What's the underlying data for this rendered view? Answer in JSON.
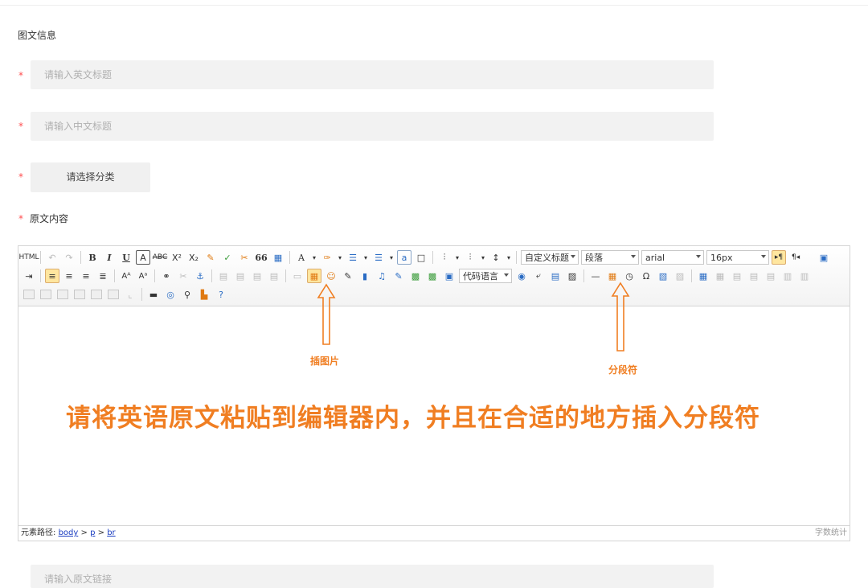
{
  "section_title": "图文信息",
  "required_mark": "*",
  "fields": {
    "english_title_placeholder": "请输入英文标题",
    "chinese_title_placeholder": "请输入中文标题",
    "category_button": "请选择分类",
    "content_label": "原文内容",
    "source_link_placeholder": "请输入原文链接"
  },
  "toolbar": {
    "row1": [
      "HTML",
      "↶",
      "↷",
      "B",
      "I",
      "U",
      "A",
      "ABC",
      "X²",
      "X₂",
      "✎",
      "✓",
      "✂",
      "66",
      "▦",
      "A",
      "▾",
      "✑",
      "▾",
      "☰",
      "▾",
      "☰",
      "▾",
      "a",
      "□",
      "⫶",
      "▾",
      "⫶",
      "▾",
      "↕",
      "▾"
    ],
    "custom_heading": "自定义标题",
    "paragraph": "段落",
    "font_family": "arial",
    "font_size": "16px",
    "code_language": "代码语言"
  },
  "statusbar": {
    "path_label": "元素路径:",
    "path_body": "body",
    "path_p": "p",
    "path_br": "br",
    "separator": ">",
    "word_count": "字数统计"
  },
  "annotations": {
    "insert_image": "插图片",
    "paragraph_break": "分段符",
    "instruction": "请将英语原文粘贴到编辑器内，并且在合适的地方插入分段符",
    "color": "#f07e22"
  },
  "colors": {
    "required": "#ff4d4f",
    "input_bg": "#f2f2f2",
    "active_button": "#ffe69f",
    "link": "#1a3dc1"
  }
}
